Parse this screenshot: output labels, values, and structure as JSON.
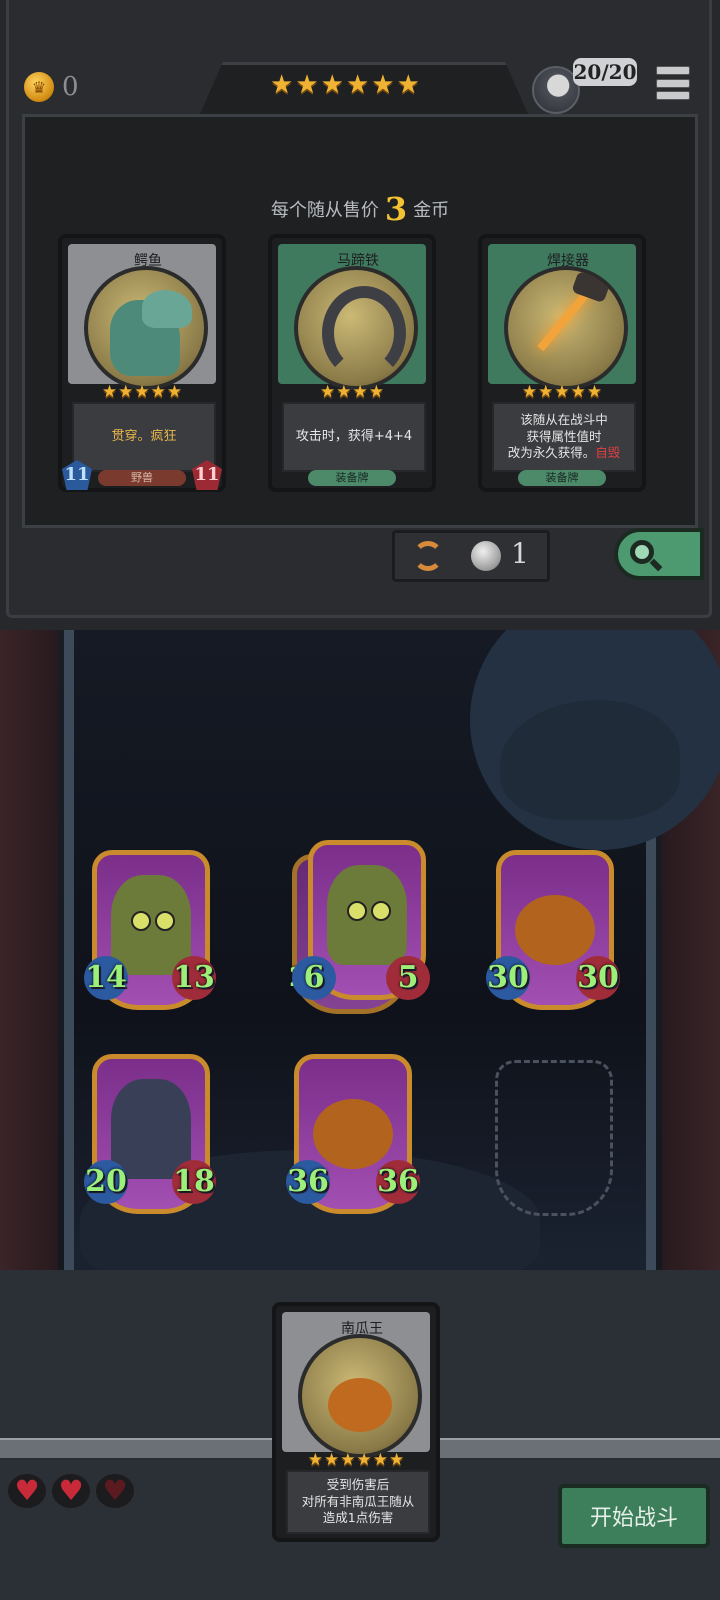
{
  "header": {
    "gold": "0",
    "health": "20/20",
    "tier_stars": 6
  },
  "shop": {
    "price_prefix": "每个随从售价",
    "price_value": "3",
    "price_suffix": "金币",
    "cards": [
      {
        "kind": "minion",
        "name": "鳄鱼",
        "stars": 5,
        "text": "贯穿。疯狂",
        "type": "野兽",
        "attack": "11",
        "health": "11"
      },
      {
        "kind": "gear",
        "name": "马蹄铁",
        "stars": 4,
        "text": "攻击时，获得+4+4",
        "type": "装备牌"
      },
      {
        "kind": "gear",
        "name": "焊接器",
        "stars": 5,
        "text_line1": "该随从在战斗中",
        "text_line2": "获得属性值时",
        "text_line3": "改为永久获得。",
        "text_keyword": "自毁",
        "type": "装备牌"
      }
    ],
    "refresh_cost": "1"
  },
  "board": {
    "minions": [
      {
        "name": "lurker-goblin",
        "attack": "14",
        "health": "13"
      },
      {
        "name": "lurker-goblin-stack",
        "attack": "6",
        "health": "5",
        "behind_value": "2"
      },
      {
        "name": "pumpkin",
        "attack": "30",
        "health": "30"
      },
      {
        "name": "scarecrow",
        "attack": "20",
        "health": "18"
      },
      {
        "name": "pumpkin",
        "attack": "36",
        "health": "36"
      }
    ]
  },
  "hand_card": {
    "name": "南瓜王",
    "stars": 6,
    "text_line1": "受到伤害后",
    "text_line2": "对所有非南瓜王随从",
    "text_line3": "造成1点伤害"
  },
  "player": {
    "hearts_total": 3,
    "hearts_remaining": 2
  },
  "start_button": "开始战斗",
  "colors": {
    "accent_gold": "#f0b232",
    "start_green": "#3d7f5a",
    "attack_blue": "#2c5aa0",
    "health_red": "#a02c3a"
  }
}
